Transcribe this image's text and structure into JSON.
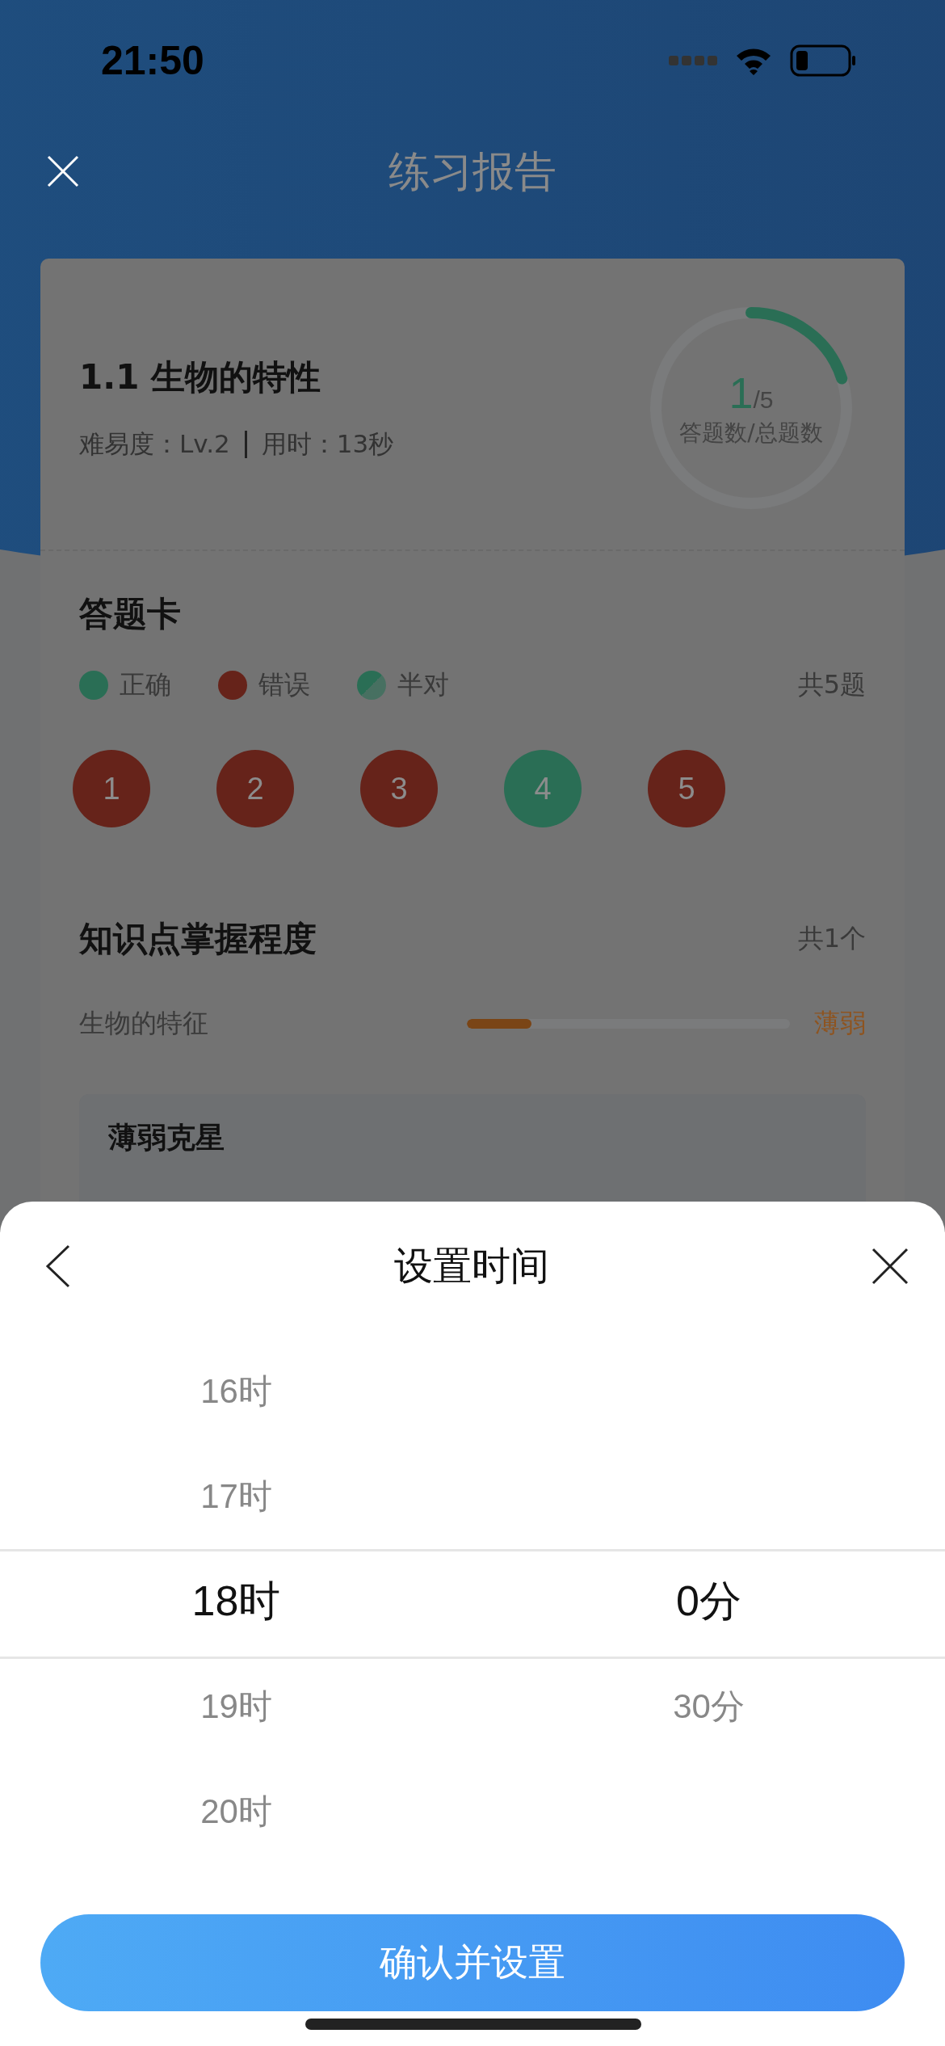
{
  "status_bar": {
    "time": "21:50"
  },
  "header": {
    "title": "练习报告"
  },
  "summary": {
    "title": "1.1 生物的特性",
    "difficulty": "难易度：Lv.2",
    "duration": "用时：13秒",
    "answered": "1",
    "total": "/5",
    "caption": "答题数/总题数",
    "level": 0.2
  },
  "answer_card": {
    "title": "答题卡",
    "count": "共5题",
    "legend": [
      {
        "label": "正确",
        "kind": "solid",
        "color": "#2a6e55"
      },
      {
        "label": "错误",
        "kind": "solid",
        "color": "#66231a"
      },
      {
        "label": "半对",
        "kind": "half",
        "color": "#2a6e55"
      }
    ],
    "questions": [
      {
        "number": "1",
        "color": "#66231a"
      },
      {
        "number": "2",
        "color": "#66231a"
      },
      {
        "number": "3",
        "color": "#66231a"
      },
      {
        "number": "4",
        "color": "#2a6e55"
      },
      {
        "number": "5",
        "color": "#66231a"
      }
    ]
  },
  "knowledge": {
    "title": "知识点掌握程度",
    "count": "共1个",
    "items": [
      {
        "name": "生物的特征",
        "level": 0.2,
        "status": "薄弱"
      }
    ]
  },
  "weak_section": {
    "title": "薄弱克星"
  },
  "sheet": {
    "title": "设置时间",
    "hours": [
      {
        "label": "16时",
        "selected": false
      },
      {
        "label": "17时",
        "selected": false
      },
      {
        "label": "18时",
        "selected": true
      },
      {
        "label": "19时",
        "selected": false
      },
      {
        "label": "20时",
        "selected": false
      }
    ],
    "minutes": [
      {
        "label": "0分",
        "selected": true
      },
      {
        "label": "30分",
        "selected": false
      }
    ],
    "button": "确认并设置"
  }
}
